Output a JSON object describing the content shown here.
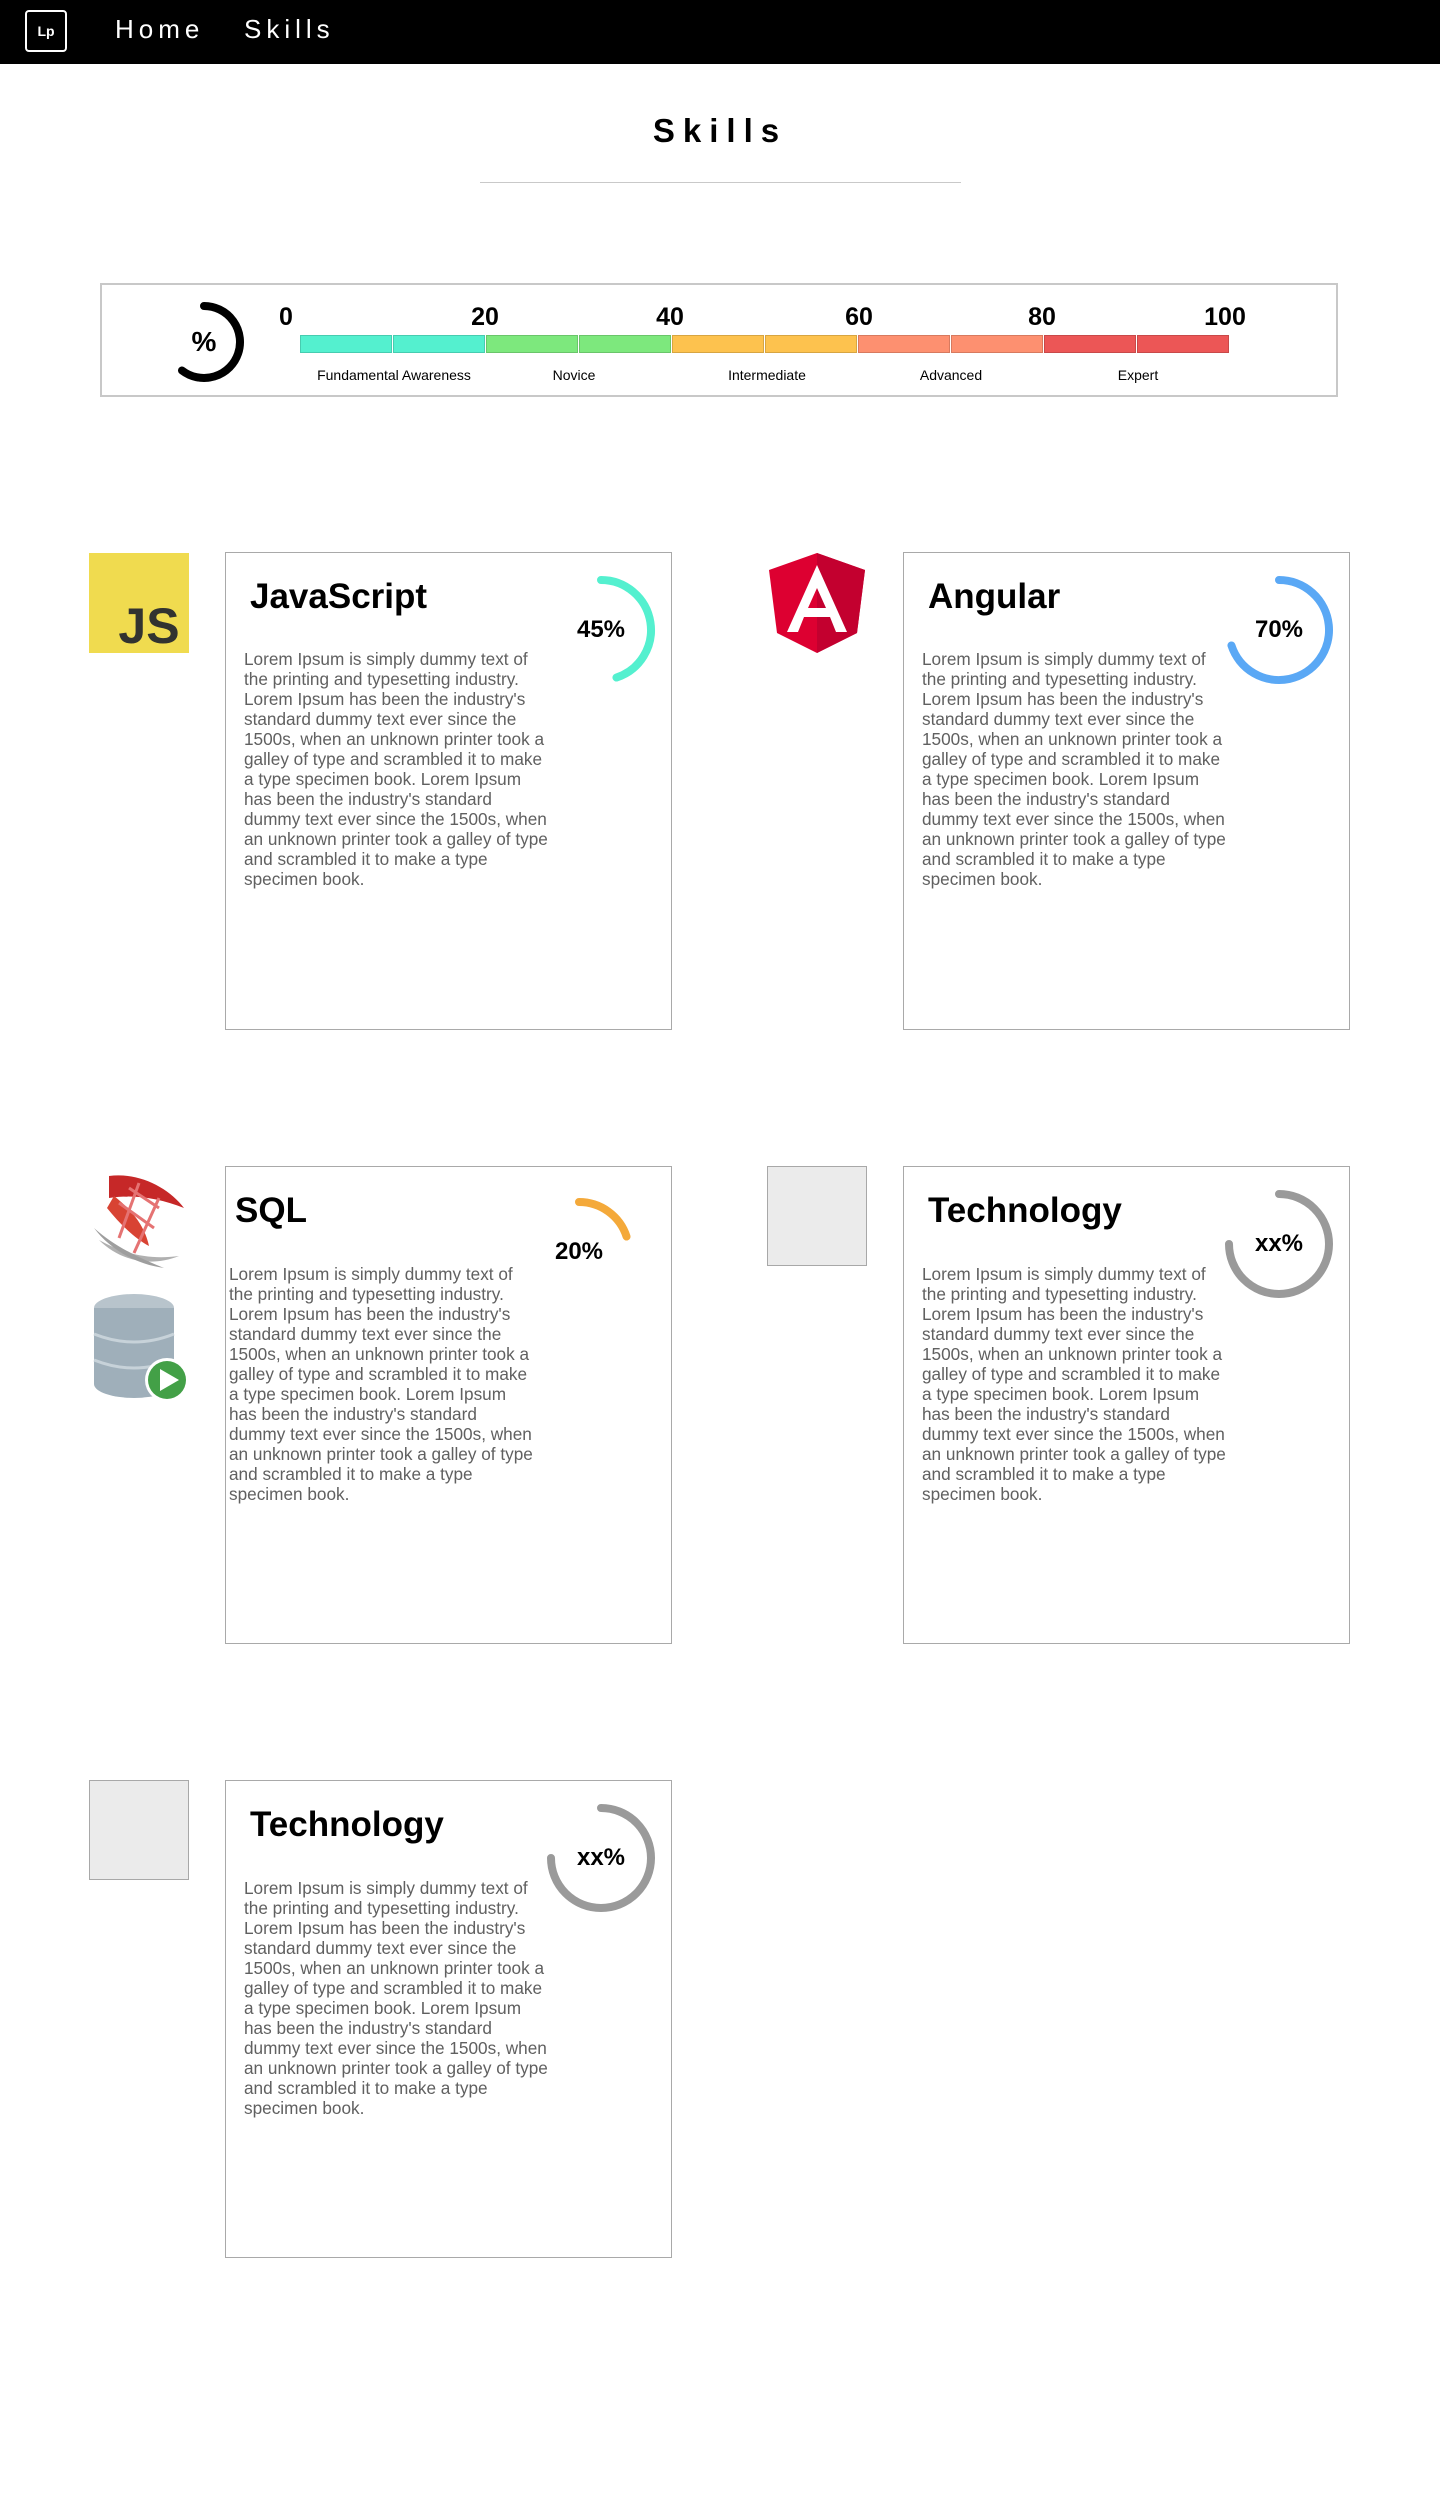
{
  "nav": {
    "logo": "Lp",
    "links": [
      "Home",
      "Skills"
    ]
  },
  "page": {
    "title": "Skills"
  },
  "legend": {
    "symbol": "%",
    "scale_numbers": [
      "0",
      "20",
      "40",
      "60",
      "80",
      "100"
    ],
    "segment_colors": [
      "#54f0cf",
      "#54f0cf",
      "#7de87d",
      "#7de87d",
      "#fdc24e",
      "#fdc24e",
      "#fd9070",
      "#fd9070",
      "#ec5656",
      "#ec5656"
    ],
    "levels": [
      "Fundamental Awareness",
      "Novice",
      "Intermediate",
      "Advanced",
      "Expert"
    ]
  },
  "skills": [
    {
      "title": "JavaScript",
      "percent_label": "45%",
      "level": 0.45,
      "color": "#54f0cf",
      "icon": "javascript-logo-icon",
      "description": "Lorem Ipsum is simply dummy text of the printing and typesetting industry. Lorem Ipsum has been the industry's standard dummy text ever since the 1500s, when an unknown printer took a galley of type and scrambled it to make a type specimen book. Lorem Ipsum has been the industry's standard dummy text ever since the 1500s, when an unknown printer took a galley of type and scrambled it to make a type specimen book."
    },
    {
      "title": "Angular",
      "percent_label": "70%",
      "level": 0.7,
      "color": "#5aa8f5",
      "icon": "angular-logo-icon",
      "description": "Lorem Ipsum is simply dummy text of the printing and typesetting industry. Lorem Ipsum has been the industry's standard dummy text ever since the 1500s, when an unknown printer took a galley of type and scrambled it to make a type specimen book. Lorem Ipsum has been the industry's standard dummy text ever since the 1500s, when an unknown printer took a galley of type and scrambled it to make a type specimen book."
    },
    {
      "title": "SQL",
      "percent_label": "20%",
      "level": 0.2,
      "color": "#f4a93a",
      "icon": "sql-server-logo-icon",
      "icon_secondary": "database-play-icon",
      "description": "Lorem Ipsum is simply dummy text of the printing and typesetting industry. Lorem Ipsum has been the industry's standard dummy text ever since the 1500s, when an unknown printer took a galley of type and scrambled it to make a type specimen book. Lorem Ipsum has been the industry's standard dummy text ever since the 1500s, when an unknown printer took a galley of type and scrambled it to make a type specimen book."
    },
    {
      "title": "Technology",
      "percent_label": "xx%",
      "level": 0.75,
      "color": "#9a9a9a",
      "icon": "placeholder-image-icon",
      "description": "Lorem Ipsum is simply dummy text of the printing and typesetting industry. Lorem Ipsum has been the industry's standard dummy text ever since the 1500s, when an unknown printer took a galley of type and scrambled it to make a type specimen book. Lorem Ipsum has been the industry's standard dummy text ever since the 1500s, when an unknown printer took a galley of type and scrambled it to make a type specimen book."
    },
    {
      "title": "Technology",
      "percent_label": "xx%",
      "level": 0.75,
      "color": "#9a9a9a",
      "icon": "placeholder-image-icon",
      "description": "Lorem Ipsum is simply dummy text of the printing and typesetting industry. Lorem Ipsum has been the industry's standard dummy text ever since the 1500s, when an unknown printer took a galley of type and scrambled it to make a type specimen book. Lorem Ipsum has been the industry's standard dummy text ever since the 1500s, when an unknown printer took a galley of type and scrambled it to make a type specimen book."
    }
  ]
}
